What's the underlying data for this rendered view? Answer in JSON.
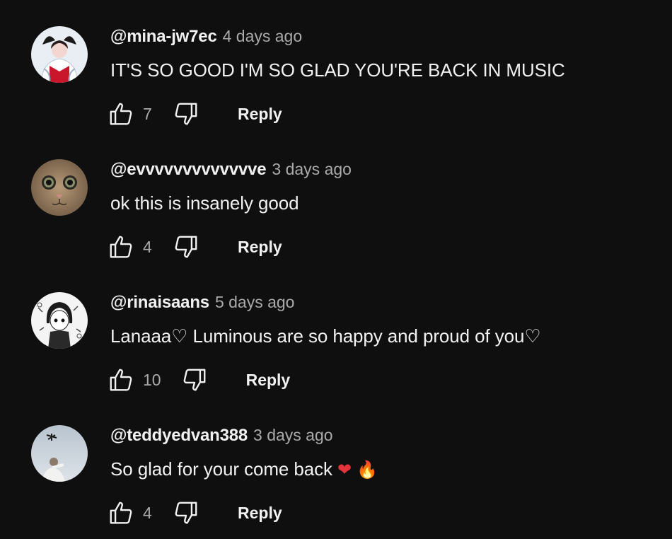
{
  "comments": [
    {
      "author": "@mina-jw7ec",
      "time": "4 days ago",
      "text": "IT'S SO GOOD I'M SO GLAD YOU'RE BACK IN MUSIC",
      "likes": "7",
      "reply_label": "Reply",
      "avatar_icon": "avatar-mina"
    },
    {
      "author": "@evvvvvvvvvvvvve",
      "time": "3 days ago",
      "text": "ok this is insanely good",
      "likes": "4",
      "reply_label": "Reply",
      "avatar_icon": "avatar-cat"
    },
    {
      "author": "@rinaisaans",
      "time": "5 days ago",
      "text": "Lanaaa♡ Luminous are so happy and proud of you♡",
      "likes": "10",
      "reply_label": "Reply",
      "avatar_icon": "avatar-anime"
    },
    {
      "author": "@teddyedvan388",
      "time": "3 days ago",
      "text": "So glad for your come back",
      "emoji_heart": "❤",
      "emoji_fire": "🔥",
      "likes": "4",
      "reply_label": "Reply",
      "avatar_icon": "avatar-sky"
    }
  ],
  "colors": {
    "background": "#0f0f0f",
    "primary_text": "#f1f1f1",
    "secondary_text": "#aaaaaa"
  }
}
